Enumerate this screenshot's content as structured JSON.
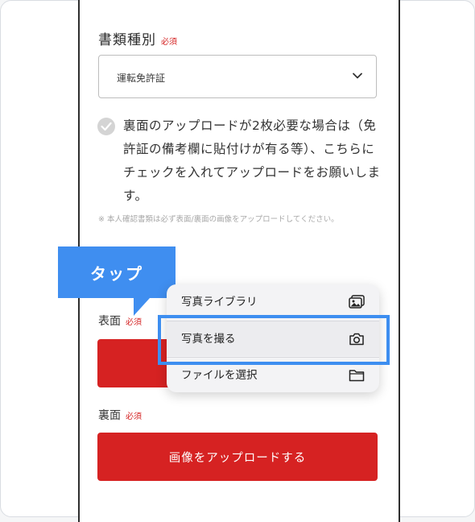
{
  "form": {
    "doc_type_label": "書類種別",
    "required_mark": "必須",
    "select_value": "運転免許証",
    "checkbox_text": "裏面のアップロードが2枚必要な場合は（免許証の備考欄に貼付けが有る等）、こちらにチェックを入れてアップロードをお願いします。",
    "note": "※ 本人確認書類は必ず表面/裏面の画像をアップロードしてください。",
    "front_label": "表面",
    "back_label": "裏面",
    "upload_button": "画像をアップロードする"
  },
  "callout": {
    "tap": "タップ"
  },
  "menu": {
    "items": [
      {
        "label": "写真ライブラリ",
        "icon": "photo-library-icon"
      },
      {
        "label": "写真を撮る",
        "icon": "camera-icon"
      },
      {
        "label": "ファイルを選択",
        "icon": "folder-icon"
      }
    ]
  },
  "colors": {
    "accent_red": "#d62222",
    "highlight_blue": "#3d8ef0"
  }
}
